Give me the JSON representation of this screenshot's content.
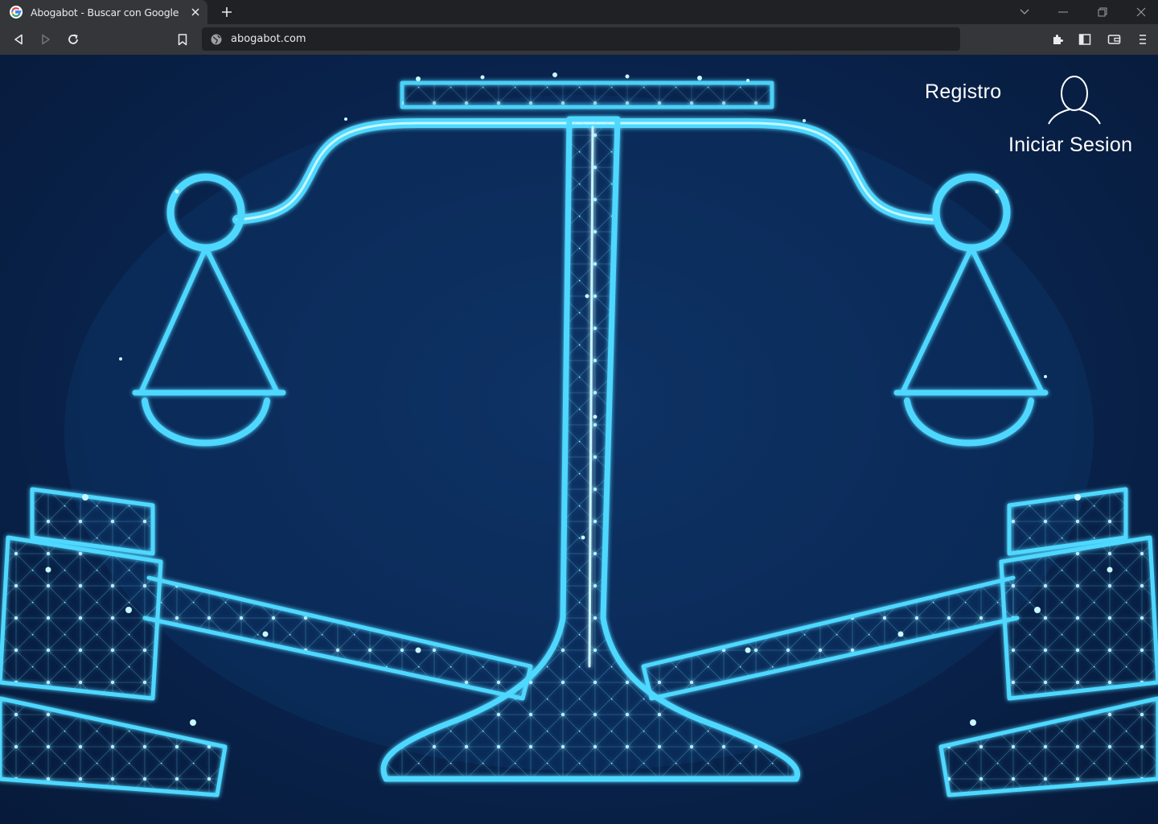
{
  "browser": {
    "tab": {
      "title": "Abogabot - Buscar con Google"
    },
    "address_bar": {
      "url": "abogabot.com"
    }
  },
  "page": {
    "nav": {
      "register_label": "Registro",
      "login_label": "Iniciar Sesion"
    }
  },
  "colors": {
    "glow": "#4fd8ff",
    "background_dark": "#071a3a",
    "chrome_dark": "#202124",
    "chrome_mid": "#35363a"
  }
}
